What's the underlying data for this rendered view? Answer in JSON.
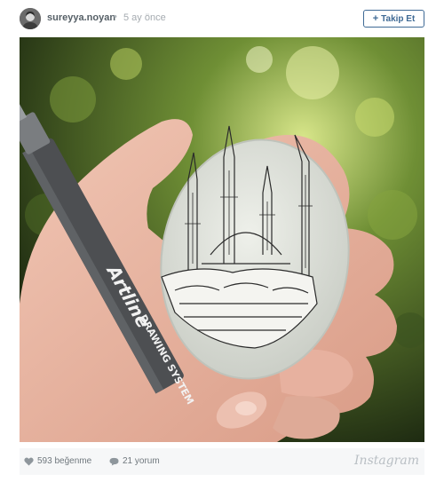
{
  "post": {
    "username": "sureyya.noyan",
    "separator": "•",
    "time_ago": "5 ay önce",
    "follow_label": "Takip Et",
    "follow_icon": "plus-icon"
  },
  "photo": {
    "marker_brand": "Artline",
    "marker_subtitle": "DRAWING SYSTEM"
  },
  "footer": {
    "likes": "593 beğenme",
    "comments": "21 yorum",
    "brand": "Instagram"
  },
  "colors": {
    "accent": "#3f6a95",
    "meta_text": "#6f777d",
    "footer_bg": "#f6f7f8"
  }
}
